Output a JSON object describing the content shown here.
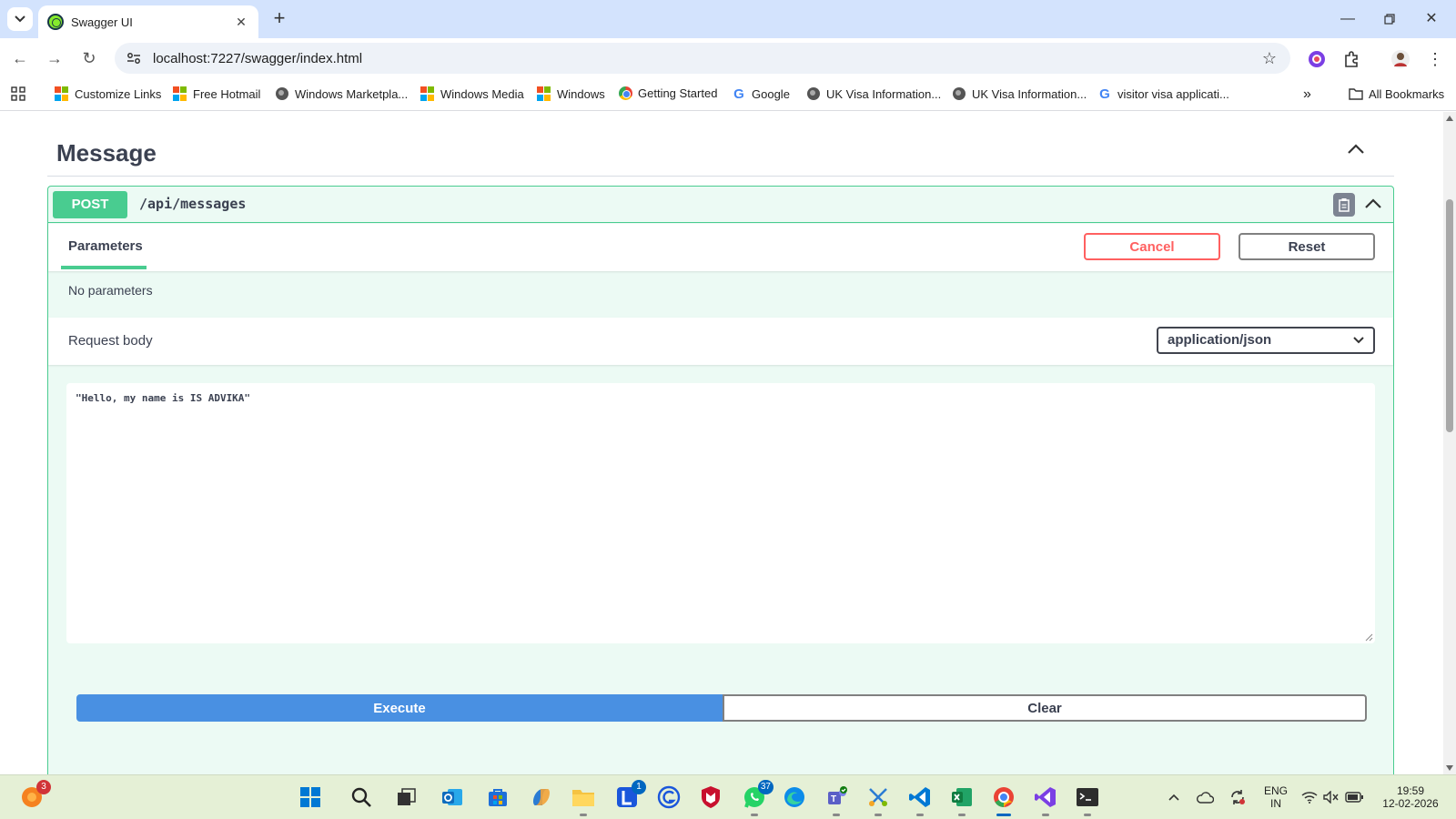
{
  "browser": {
    "tab_title": "Swagger UI",
    "url": "localhost:7227/swagger/index.html",
    "new_tab_label": "+",
    "bookmarks": [
      {
        "label": "Customize Links",
        "icon": "windows-logo-icon"
      },
      {
        "label": "Free Hotmail",
        "icon": "windows-logo-icon"
      },
      {
        "label": "Windows Marketpla...",
        "icon": "globe-icon"
      },
      {
        "label": "Windows Media",
        "icon": "windows-logo-icon"
      },
      {
        "label": "Windows",
        "icon": "windows-logo-icon"
      },
      {
        "label": "Getting Started",
        "icon": "chrome-icon"
      },
      {
        "label": "Google",
        "icon": "google-icon"
      },
      {
        "label": "UK Visa Information...",
        "icon": "globe-icon"
      },
      {
        "label": "UK Visa Information...",
        "icon": "globe-icon"
      },
      {
        "label": "visitor visa applicati...",
        "icon": "google-icon"
      }
    ],
    "bookmarks_overflow": "»",
    "all_bookmarks_label": "All Bookmarks"
  },
  "section": {
    "title": "Message"
  },
  "operation": {
    "method": "POST",
    "path": "/api/messages",
    "parameters_tab": "Parameters",
    "cancel_label": "Cancel",
    "reset_label": "Reset",
    "no_parameters_text": "No parameters",
    "request_body_label": "Request body",
    "content_type": "application/json",
    "request_body_value": "\"Hello, my name is IS ADVIKA\"",
    "execute_label": "Execute",
    "clear_label": "Clear"
  },
  "taskbar": {
    "notification_badge": "3",
    "l_app_badge": "1",
    "whatsapp_badge": "37",
    "language_line1": "ENG",
    "language_line2": "IN",
    "time": "19:59",
    "date": "12-02-2026"
  },
  "colors": {
    "post_green": "#49cc90",
    "execute_blue": "#4990e2",
    "cancel_red": "#ff6060",
    "tab_strip": "#d3e3fd",
    "taskbar_bg": "#e5f0d6"
  }
}
